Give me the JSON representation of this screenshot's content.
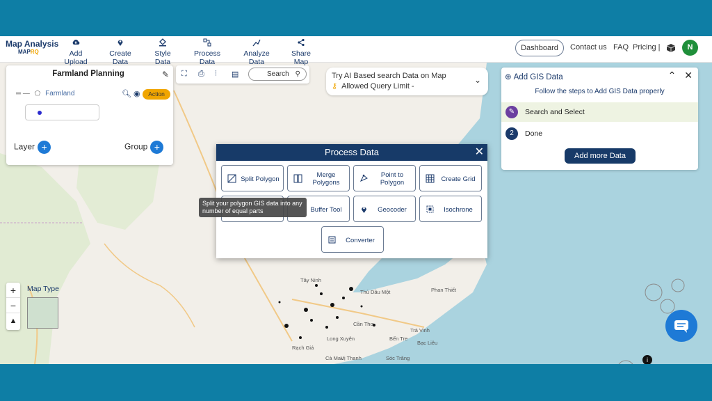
{
  "nav": {
    "logo_title": "Map Analysis",
    "logo_sub_a": "MAP",
    "logo_sub_b": "RQ",
    "items": [
      {
        "label": "Add Upload",
        "icon": "cloud-upload-icon"
      },
      {
        "label": "Create Data",
        "icon": "map-pin-icon"
      },
      {
        "label": "Style Data",
        "icon": "paint-bucket-icon"
      },
      {
        "label": "Process Data",
        "icon": "process-icon"
      },
      {
        "label": "Analyze Data",
        "icon": "analyze-icon"
      },
      {
        "label": "Share Map",
        "icon": "share-icon"
      }
    ],
    "dashboard": "Dashboard",
    "contact": "Contact us",
    "faq": "FAQ",
    "pricing": "Pricing |",
    "avatar_initial": "N"
  },
  "layers_panel": {
    "title": "Farmland Planning",
    "layer_name": "Farmland",
    "action_label": "Action",
    "layer_label": "Layer",
    "group_label": "Group"
  },
  "toolbar": {
    "search_label": "Search"
  },
  "ai_search": {
    "line1": "Try AI Based search Data on Map",
    "line2": "Allowed Query Limit -"
  },
  "gis_panel": {
    "title": "Add GIS Data",
    "subtitle": "Follow the steps to Add GIS Data properly",
    "steps": [
      {
        "num": "",
        "label": "Search and Select"
      },
      {
        "num": "2",
        "label": "Done"
      }
    ],
    "add_more": "Add more Data"
  },
  "process_modal": {
    "title": "Process Data",
    "tooltip": "Split your polygon GIS data into any number of equal parts",
    "buttons": [
      {
        "label": "Split Polygon",
        "icon": "split-polygon-icon"
      },
      {
        "label": "Merge Polygons",
        "icon": "merge-polygons-icon"
      },
      {
        "label": "Point to Polygon",
        "icon": "point-to-polygon-icon"
      },
      {
        "label": "Create Grid",
        "icon": "grid-icon"
      },
      {
        "label": "",
        "icon": ""
      },
      {
        "label": "Buffer Tool",
        "icon": "buffer-icon"
      },
      {
        "label": "Geocoder",
        "icon": "geocoder-icon"
      },
      {
        "label": "Isochrone",
        "icon": "isochrone-icon"
      },
      {
        "label": "Converter",
        "icon": "converter-icon"
      }
    ]
  },
  "map": {
    "map_type_label": "Map Type",
    "places": [
      "Phan Thiết",
      "Thủ Dầu Một",
      "Cần Thơ",
      "Rạch Giá",
      "Long Xuyên",
      "Vị Thanh",
      "Sóc Trăng",
      "Bạc Liêu",
      "Cà Mau",
      "Trà Vinh",
      "Bến Tre",
      "Tây Ninh"
    ]
  },
  "colors": {
    "navy": "#173a68",
    "accent_blue": "#1e7ad6",
    "action_orange": "#f0a500",
    "background_teal": "#0e7ea5"
  }
}
